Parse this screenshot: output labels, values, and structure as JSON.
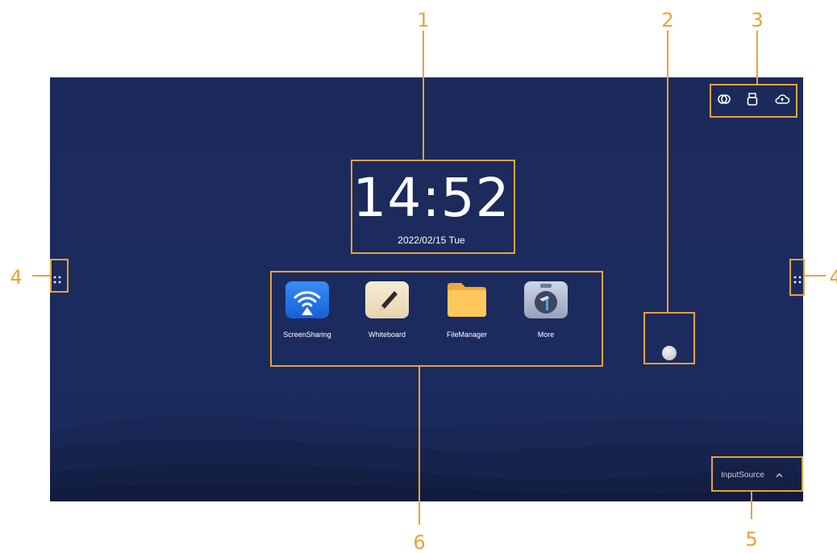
{
  "clock": {
    "time": "14:52",
    "date": "2022/02/15 Tue"
  },
  "status_icons": [
    "link-icon",
    "usb-drive-icon",
    "cloud-icon"
  ],
  "apps": [
    {
      "label": "ScreenSharing",
      "icon": "wifi-cast-icon"
    },
    {
      "label": "Whiteboard",
      "icon": "pen-icon"
    },
    {
      "label": "FileManager",
      "icon": "folder-icon"
    },
    {
      "label": "More",
      "icon": "toolbox-icon"
    }
  ],
  "input_source": {
    "label": "InputSource"
  },
  "callouts": {
    "1": "1",
    "2": "2",
    "3": "3",
    "4_left": "4",
    "4_right": "4",
    "5": "5",
    "6": "6"
  },
  "colors": {
    "screen_bg": "#1b2a5a",
    "callout": "#e8a23a",
    "text": "#ffffff"
  }
}
